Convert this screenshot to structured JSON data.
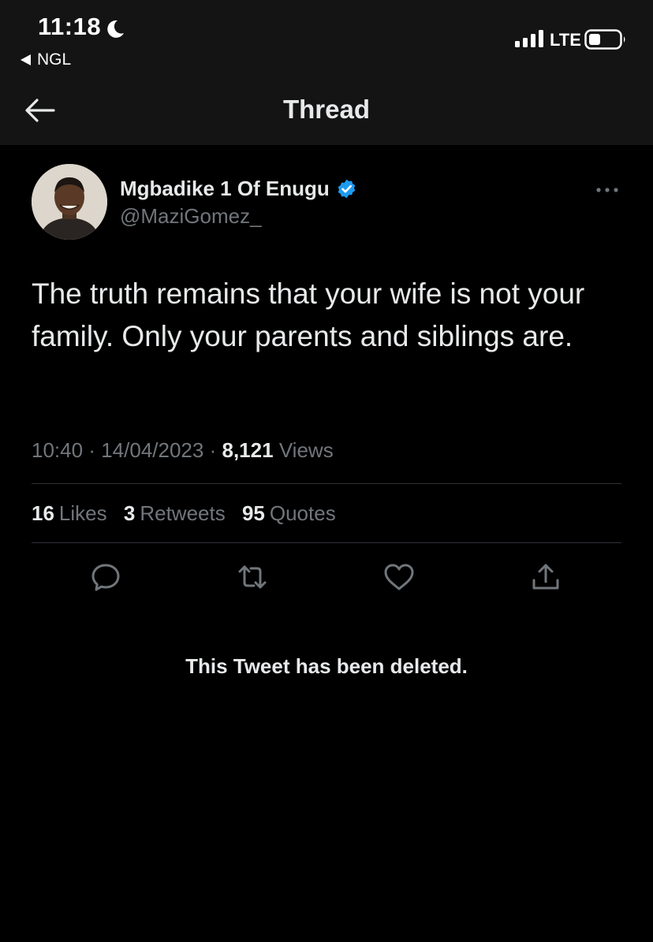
{
  "status_bar": {
    "time": "11:18",
    "back_app": "NGL",
    "network": "LTE",
    "icons": [
      "moon-icon",
      "signal-icon",
      "battery-icon"
    ]
  },
  "header": {
    "title": "Thread",
    "back_icon": "arrow-left-icon"
  },
  "tweet": {
    "display_name": "Mgbadike 1 Of Enugu",
    "handle": "@MaziGomez_",
    "verified": true,
    "text": "The truth remains that your wife is not your family. Only your parents and siblings are.",
    "time": "10:40",
    "date": "14/04/2023",
    "separator": "·",
    "views_count": "8,121",
    "views_label": "Views",
    "likes_count": "16",
    "likes_label": "Likes",
    "retweets_count": "3",
    "retweets_label": "Retweets",
    "quotes_count": "95",
    "quotes_label": "Quotes"
  },
  "actions": {
    "icons": [
      "reply-icon",
      "retweet-icon",
      "like-icon",
      "share-icon"
    ]
  },
  "deleted_notice": "This Tweet has been deleted.",
  "colors": {
    "background": "#000000",
    "header_background": "#141414",
    "primary_text": "#e7e9ea",
    "secondary_text": "#71767b",
    "divider": "#2f3336",
    "verified_blue": "#1d9bf0"
  }
}
